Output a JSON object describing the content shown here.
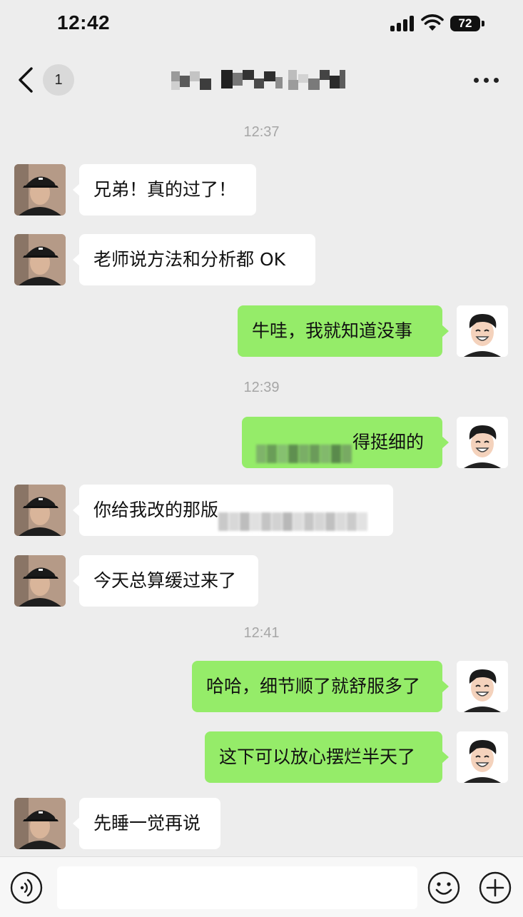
{
  "status_bar": {
    "time": "12:42",
    "battery": "72"
  },
  "nav": {
    "unread_count": "1"
  },
  "messages": [
    {
      "type": "time",
      "text": "12:37"
    },
    {
      "type": "in",
      "text": "兄弟！真的过了！"
    },
    {
      "type": "in",
      "text": "老师说方法和分析都 OK"
    },
    {
      "type": "out",
      "text": "牛哇，我就知道没事"
    },
    {
      "type": "time",
      "text": "12:39"
    },
    {
      "type": "out",
      "text": "得挺细的",
      "redacted_prefix": true
    },
    {
      "type": "in",
      "text": "你给我改的那版",
      "redacted_suffix": true
    },
    {
      "type": "in",
      "text": "今天总算缓过来了"
    },
    {
      "type": "time",
      "text": "12:41"
    },
    {
      "type": "out",
      "text": "哈哈，细节顺了就舒服多了"
    },
    {
      "type": "out",
      "text": "这下可以放心摆烂半天了"
    },
    {
      "type": "in",
      "text": "先睡一觉再说"
    }
  ],
  "icons": {
    "back": "chevron-left-icon",
    "more": "more-dots-icon",
    "voice": "voice-icon",
    "emoji": "emoji-icon",
    "plus": "plus-icon"
  },
  "colors": {
    "background": "#ededed",
    "outgoing_bubble": "#95ec69",
    "incoming_bubble": "#ffffff",
    "timestamp": "#a6a6a6"
  },
  "input": {
    "value": "",
    "placeholder": ""
  }
}
